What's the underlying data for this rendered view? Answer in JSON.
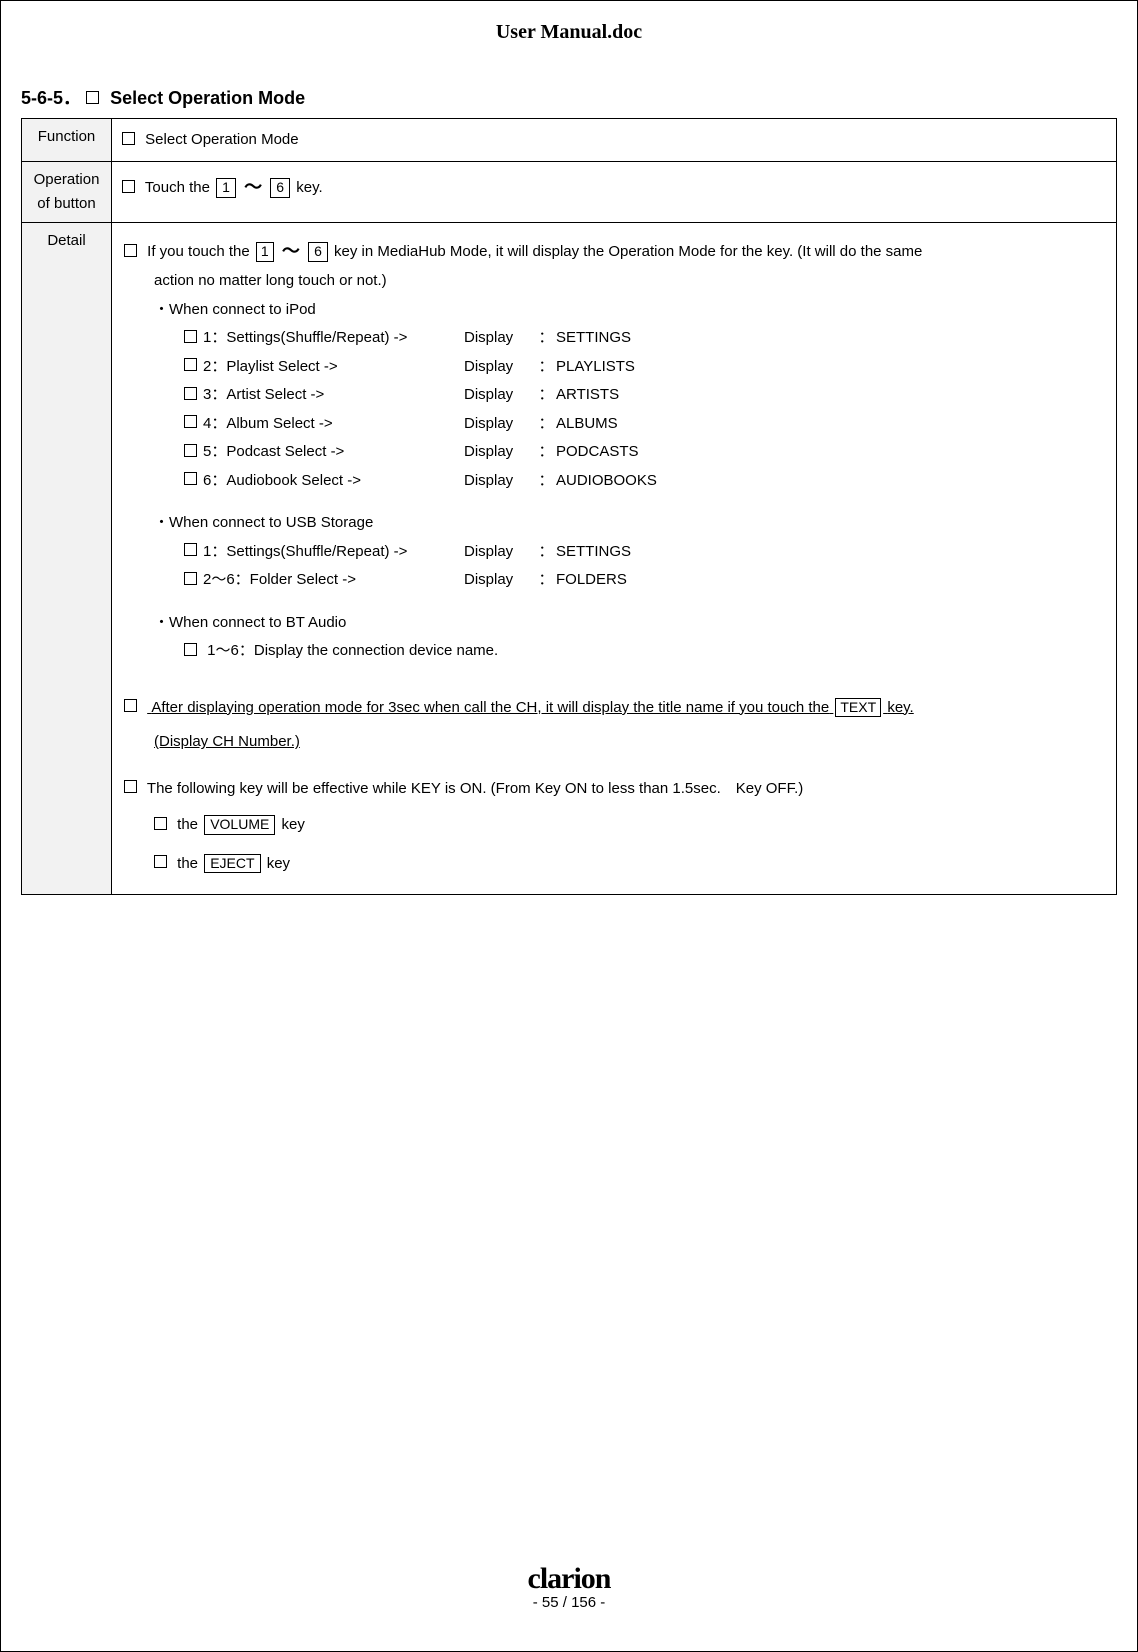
{
  "doc_title": "User Manual.doc",
  "section": {
    "number": "5-6-5．",
    "title": "Select Operation Mode"
  },
  "row_labels": {
    "function": "Function",
    "operation": "Operation of button",
    "detail": "Detail"
  },
  "function_text": "Select Operation Mode",
  "operation": {
    "prefix": "Touch the",
    "key_from": "1",
    "tilde": "～",
    "key_to": "6",
    "suffix": "key."
  },
  "detail": {
    "intro": {
      "prefix": "If you touch the",
      "key_from": "1",
      "tilde": "～",
      "key_to": "6",
      "mid": "key in MediaHub Mode, it will display the Operation Mode for the key. (It will do the same",
      "line2": "action no matter long touch or not.)"
    },
    "ipod_header": "・When connect to iPod",
    "ipod_items": [
      {
        "left": "1：Settings(Shuffle/Repeat) ->",
        "disp": "SETTINGS"
      },
      {
        "left": "2：Playlist Select ->",
        "disp": "PLAYLISTS"
      },
      {
        "left": "3：Artist Select ->",
        "disp": "ARTISTS"
      },
      {
        "left": "4：Album Select ->",
        "disp": "ALBUMS"
      },
      {
        "left": "5：Podcast Select ->",
        "disp": "PODCASTS"
      },
      {
        "left": "6：Audiobook Select ->",
        "disp": "AUDIOBOOKS"
      }
    ],
    "usb_header": "・When connect to USB Storage",
    "usb_items": [
      {
        "left": "1：Settings(Shuffle/Repeat) ->",
        "disp": "SETTINGS"
      },
      {
        "left": "2～6：Folder Select ->",
        "disp": "FOLDERS"
      }
    ],
    "bt_header": "・When connect to BT Audio",
    "bt_item": "1～6：Display the connection device name.",
    "display_label": "Display",
    "colon": "：",
    "after_disp": {
      "part1": "After displaying operation mode for 3sec when call the CH, it will display the title name if you touch the",
      "key": "TEXT",
      "part2": "key.",
      "line2": "(Display CH Number.)"
    },
    "effective_line": "The following key will be effective while KEY is ON. (From Key ON to less than 1.5sec.　Key OFF.)",
    "eff_key1_prefix": "the",
    "eff_key1": "VOLUME",
    "eff_key1_suffix": "key",
    "eff_key2_prefix": "the",
    "eff_key2": "EJECT",
    "eff_key2_suffix": "key"
  },
  "footer": {
    "brand": "clarion",
    "page": "- 55 / 156 -"
  }
}
